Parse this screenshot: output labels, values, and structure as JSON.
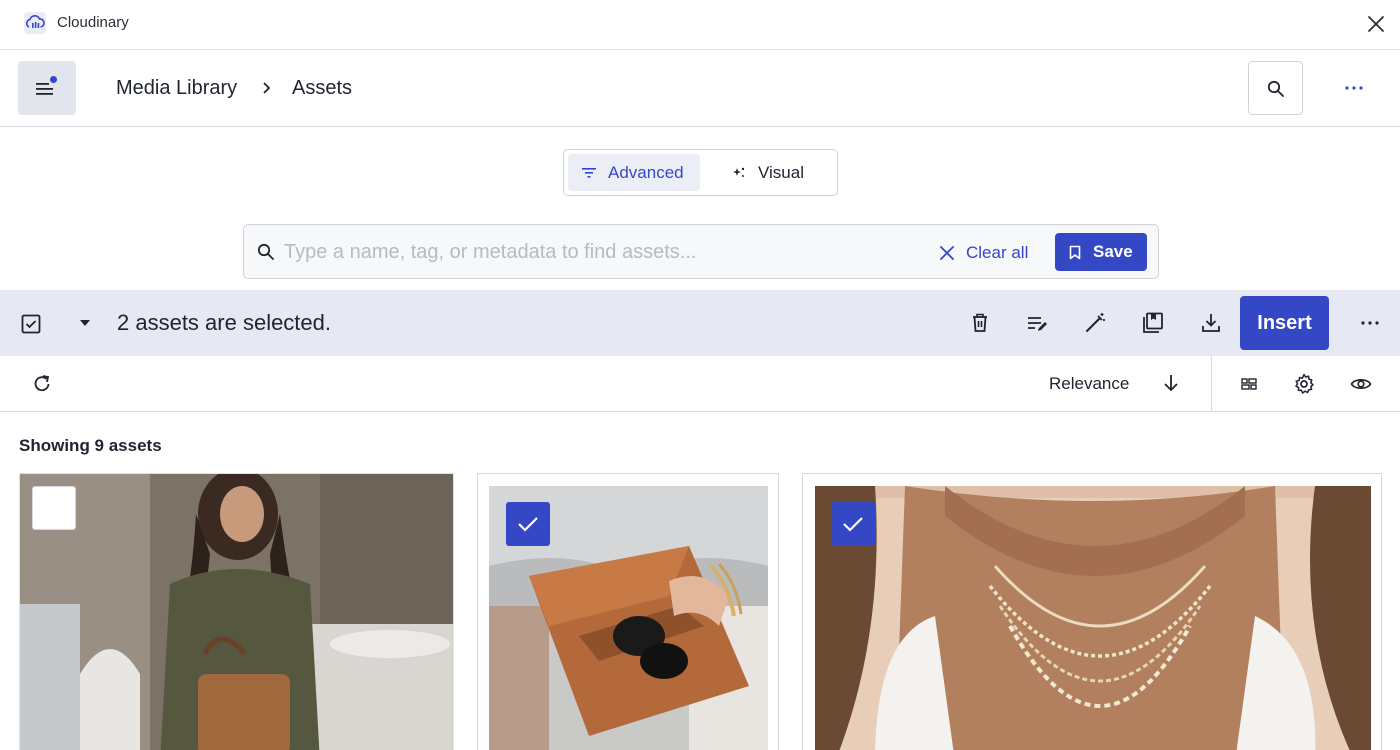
{
  "app": {
    "title": "Cloudinary",
    "brand_color": "#3448c5"
  },
  "header": {
    "breadcrumb": [
      "Media Library",
      "Assets"
    ],
    "search_icon": "search-icon",
    "more_icon": "more-horizontal-icon"
  },
  "search_mode": {
    "options": [
      {
        "label": "Advanced",
        "icon": "filter-icon",
        "selected": true
      },
      {
        "label": "Visual",
        "icon": "sparkle-icon",
        "selected": false
      }
    ]
  },
  "search": {
    "value": "",
    "placeholder": "Type a name, tag, or metadata to find assets...",
    "clear_label": "Clear all",
    "save_label": "Save"
  },
  "selection_bar": {
    "text": "2 assets are selected.",
    "actions": [
      "trash-icon",
      "edit-list-icon",
      "magic-wand-icon",
      "collection-icon",
      "download-icon"
    ],
    "insert_label": "Insert"
  },
  "toolbar": {
    "sort_label": "Relevance",
    "sort_direction": "descending",
    "view_icons": [
      "grid-view-icon",
      "settings-icon",
      "eye-icon"
    ]
  },
  "content": {
    "showing_label": "Showing 9 assets",
    "assets": [
      {
        "selected": false,
        "subject": "woman with brown leather bag"
      },
      {
        "selected": true,
        "subject": "brown clutch with sunglasses"
      },
      {
        "selected": true,
        "subject": "layered necklaces"
      }
    ]
  }
}
